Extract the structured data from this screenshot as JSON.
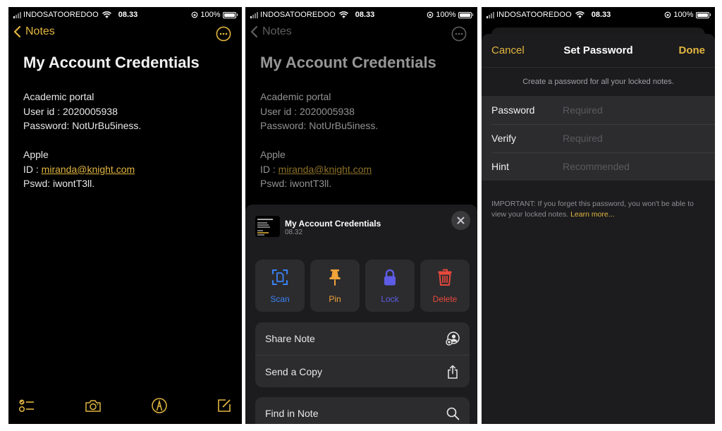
{
  "status_bar": {
    "carrier": "INDOSATOOREDOO",
    "time": "08.33",
    "battery": "100%"
  },
  "colors": {
    "accent": "#e2b640",
    "scan": "#3a82f7",
    "pin": "#f2a33a",
    "lock": "#5e5ce6",
    "delete": "#e5483c"
  },
  "note": {
    "back_label": "Notes",
    "title": "My Account Credentials",
    "lines": [
      "Academic portal",
      "User id : 2020005938",
      "Password: NotUrBu5iness.",
      "",
      "Apple",
      "ID : ",
      "Pswd: iwontT3ll."
    ],
    "email_link": "miranda@knight.com",
    "toolbar": [
      "checklist-icon",
      "camera-icon",
      "markup-icon",
      "compose-icon"
    ]
  },
  "action_sheet": {
    "note_title": "My Account Credentials",
    "note_time": "08.32",
    "actions": [
      {
        "label": "Scan",
        "icon": "scan-icon"
      },
      {
        "label": "Pin",
        "icon": "pin-icon"
      },
      {
        "label": "Lock",
        "icon": "lock-icon"
      },
      {
        "label": "Delete",
        "icon": "trash-icon"
      }
    ],
    "rows": [
      {
        "label": "Share Note",
        "icon": "share-note-icon"
      },
      {
        "label": "Send a Copy",
        "icon": "share-icon"
      },
      {
        "label": "Find in Note",
        "icon": "search-icon"
      }
    ]
  },
  "set_password": {
    "cancel_label": "Cancel",
    "title": "Set Password",
    "done_label": "Done",
    "description": "Create a password for all your locked notes.",
    "fields": [
      {
        "label": "Password",
        "placeholder": "Required"
      },
      {
        "label": "Verify",
        "placeholder": "Required"
      },
      {
        "label": "Hint",
        "placeholder": "Recommended"
      }
    ],
    "important_text": "IMPORTANT: If you forget this password, you won't be able to view your locked notes.",
    "learn_more": "Learn more..."
  }
}
